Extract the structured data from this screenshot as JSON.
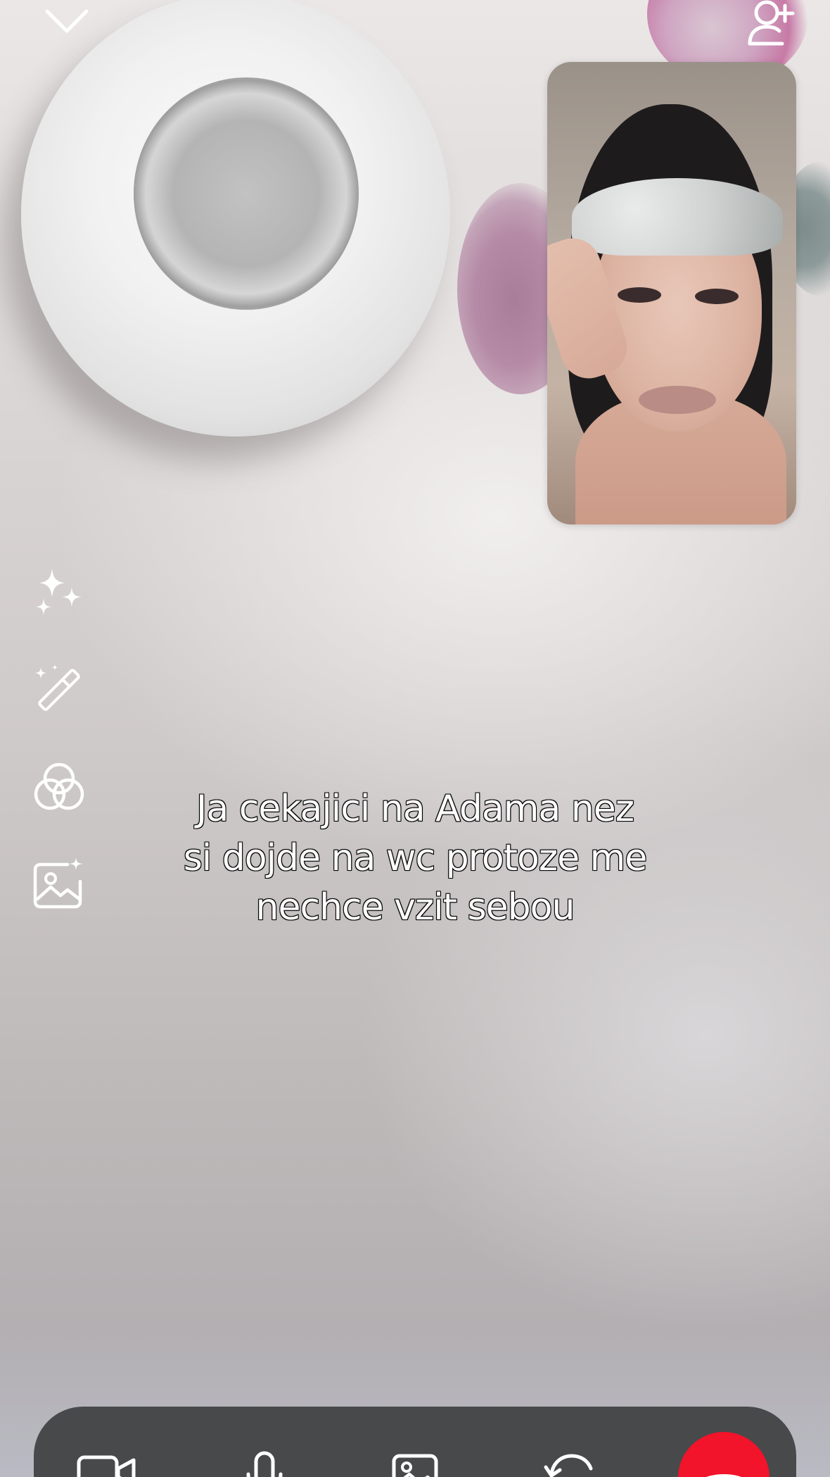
{
  "app": {
    "screen": "video-call"
  },
  "caption": {
    "lines": [
      "Ja cekajici na Adama nez",
      "si dojde na wc protoze me",
      "nechce vzit sebou"
    ]
  },
  "top_bar": {
    "left_icon": "chevron-down-icon",
    "right_icon": "add-person-icon"
  },
  "effects_toolbar": {
    "items": [
      {
        "icon": "sparkles-icon"
      },
      {
        "icon": "magic-wand-icon"
      },
      {
        "icon": "filters-icon"
      },
      {
        "icon": "background-image-icon"
      }
    ]
  },
  "call_controls": {
    "items": [
      {
        "icon": "video-camera-icon"
      },
      {
        "icon": "microphone-icon"
      },
      {
        "icon": "photo-gallery-icon"
      },
      {
        "icon": "flip-camera-icon"
      },
      {
        "icon": "end-call-icon"
      }
    ]
  },
  "colors": {
    "end_call": "#f1142a",
    "control_bar": "#48494b",
    "icon": "#ffffff"
  }
}
